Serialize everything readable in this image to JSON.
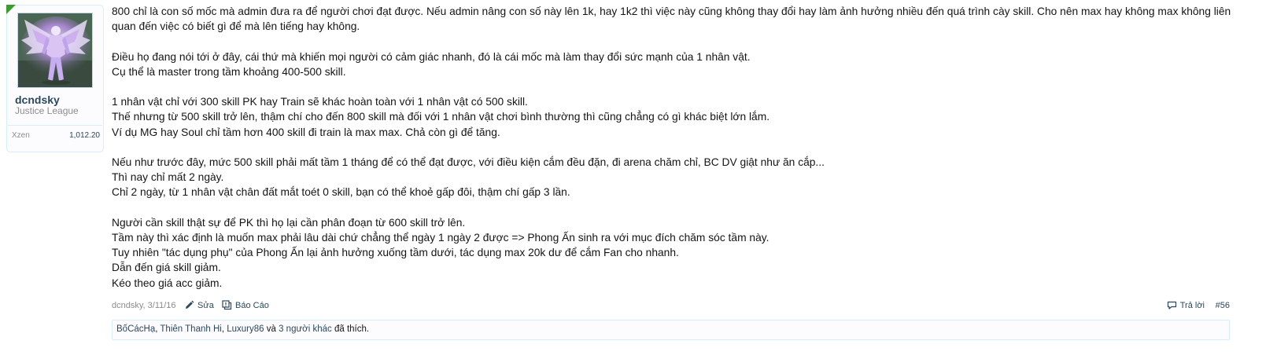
{
  "user": {
    "name": "dcndsky",
    "title": "Justice League",
    "extra_label": "Xzen",
    "extra_value": "1,012.20"
  },
  "message": {
    "paragraphs": [
      [
        "800 chỉ là con số mốc mà admin đưa ra để người chơi đạt được. Nếu admin nâng con số này lên 1k, hay 1k2 thì việc này cũng không thay đổi hay làm ảnh hưởng nhiều đến quá trình cày skill. Cho nên max hay không max không liên",
        "quan đến việc có biết gì để mà lên tiếng hay không."
      ],
      [
        "Điều họ đang nói tới ở đây, cái thứ mà khiến mọi người có cảm giác nhanh, đó là cái mốc mà làm thay đổi sức mạnh của 1 nhân vật.",
        "Cụ thể là master trong tầm khoảng 400-500 skill."
      ],
      [
        "1 nhân vật chỉ với 300 skill PK hay Train sẽ khác hoàn toàn với 1 nhân vật có 500 skill.",
        "Thế nhưng từ 500 skill trở lên, thậm chí cho đến 800 skill mà đối với 1 nhân vật chơi bình thường thì cũng chẳng có gì khác biệt lớn lắm.",
        "Ví dụ MG hay Soul chỉ tầm hơn 400 skill đi train là max max. Chả còn gì để tăng."
      ],
      [
        "Nếu như trước đây, mức 500 skill phải mất tầm 1 tháng để có thể đạt được, với điều kiện cắm đều đặn, đi arena chăm chỉ, BC DV giật như ăn cắp...",
        "Thì nay chỉ mất 2 ngày.",
        "Chỉ 2 ngày, từ 1 nhân vật chân đất mắt toét 0 skill, bạn có thể khoẻ gấp đôi, thậm chí gấp 3 lần."
      ],
      [
        "Người cần skill thật sự để PK thì họ lại cần phân đoạn từ 600 skill trở lên.",
        "Tầm này thì xác định là muốn max phải lâu dài chứ chẳng thể ngày 1 ngày 2 được => Phong Ấn sinh ra với mục đích chăm sóc tầm này.",
        "Tuy nhiên \"tác dụng phụ\" của Phong Ấn lại ảnh hưởng xuống tầm dưới, tác dụng max 20k dư để cắm Fan cho nhanh.",
        "Dẫn đến giá skill giảm.",
        "Kéo theo giá acc giảm."
      ]
    ]
  },
  "meta": {
    "author_date": "dcndsky, 3/11/16",
    "edit_label": "Sửa",
    "report_label": "Báo Cáo",
    "reply_label": "Trả lời",
    "post_number": "#56"
  },
  "likes": {
    "users": [
      "BốCácHạ",
      "Thiên Thanh Hi",
      "Luxury86"
    ],
    "and_word": "và",
    "others_link": "3 người khác",
    "suffix": "đã thích."
  },
  "colors": {
    "link": "#2b485c",
    "border": "#d7edfc",
    "muted": "#8c8c8c",
    "text": "#141414"
  }
}
